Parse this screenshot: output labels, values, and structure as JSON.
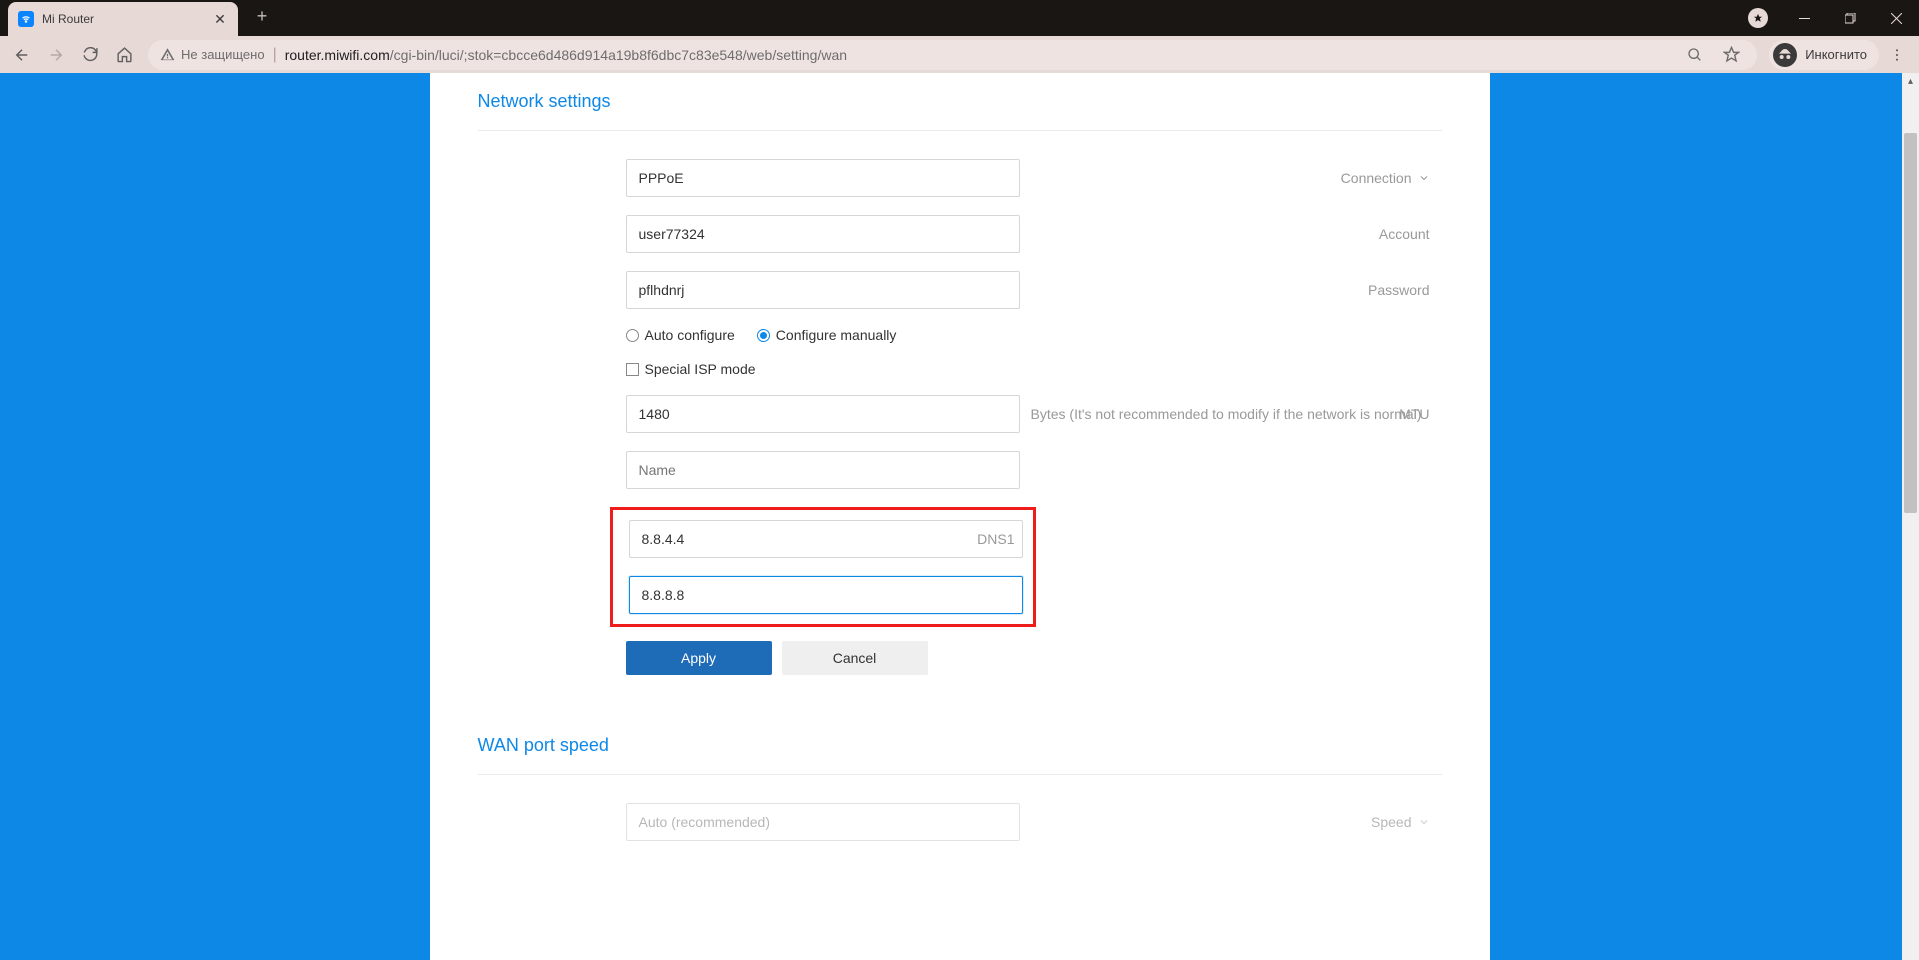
{
  "browser": {
    "tab_title": "Mi Router",
    "new_tab": "+",
    "security_label": "Не защищено",
    "url_host": "router.miwifi.com",
    "url_path": "/cgi-bin/luci/;stok=cbcce6d486d914a19b8f6dbc7c83e548/web/setting/wan",
    "profile_label": "Инкогнито"
  },
  "page": {
    "section_title": "Network settings",
    "connection": {
      "value": "PPPoE",
      "suffix": "Connection"
    },
    "account": {
      "value": "user77324",
      "suffix": "Account"
    },
    "password": {
      "value": "pflhdnrj",
      "suffix": "Password"
    },
    "config_mode": {
      "auto": "Auto configure",
      "manual": "Configure manually",
      "selected": "manual"
    },
    "special_isp": {
      "label": "Special ISP mode",
      "checked": false
    },
    "mtu": {
      "value": "1480",
      "suffix": "MTU",
      "hint": "Bytes (It's not recommended to modify if the network is normal)"
    },
    "name": {
      "value": "",
      "placeholder": "Name"
    },
    "dns1": {
      "value": "8.8.4.4",
      "suffix": "DNS1"
    },
    "dns2": {
      "value": "8.8.8.8",
      "suffix": ""
    },
    "apply_btn": "Apply",
    "cancel_btn": "Cancel",
    "wan_speed_title": "WAN port speed",
    "wan_speed": {
      "value": "Auto (recommended)",
      "suffix": "Speed"
    }
  }
}
